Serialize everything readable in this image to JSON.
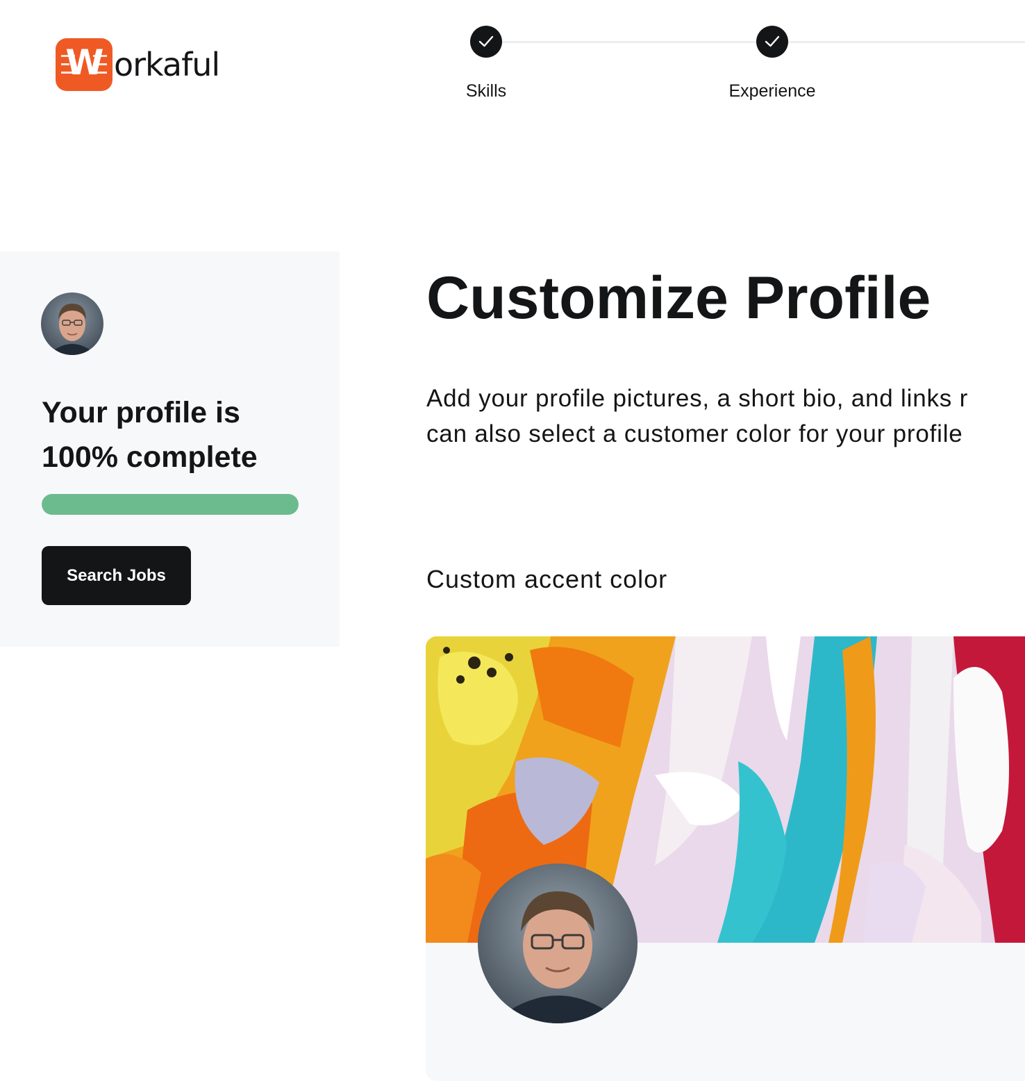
{
  "brand": {
    "wordmark": "orkaful",
    "badge_letter": "W",
    "color": "#ef5a24"
  },
  "stepper": {
    "steps": [
      {
        "label": "Skills",
        "status": "complete",
        "icon": "check-icon"
      },
      {
        "label": "Experience",
        "status": "complete",
        "icon": "check-icon"
      }
    ]
  },
  "sidebar": {
    "avatar": "user-avatar",
    "completion_text": "Your profile is 100% complete",
    "progress_percent": 100,
    "progress_color": "#6cbb8e",
    "search_button_label": "Search Jobs"
  },
  "main": {
    "title": "Customize Profile",
    "description_lines": [
      "Add your profile pictures, a short bio, and links r",
      "can also select a customer color for your profile"
    ],
    "accent_label": "Custom accent color",
    "cover_image": "abstract-paint-cover",
    "profile_avatar": "user-avatar"
  }
}
